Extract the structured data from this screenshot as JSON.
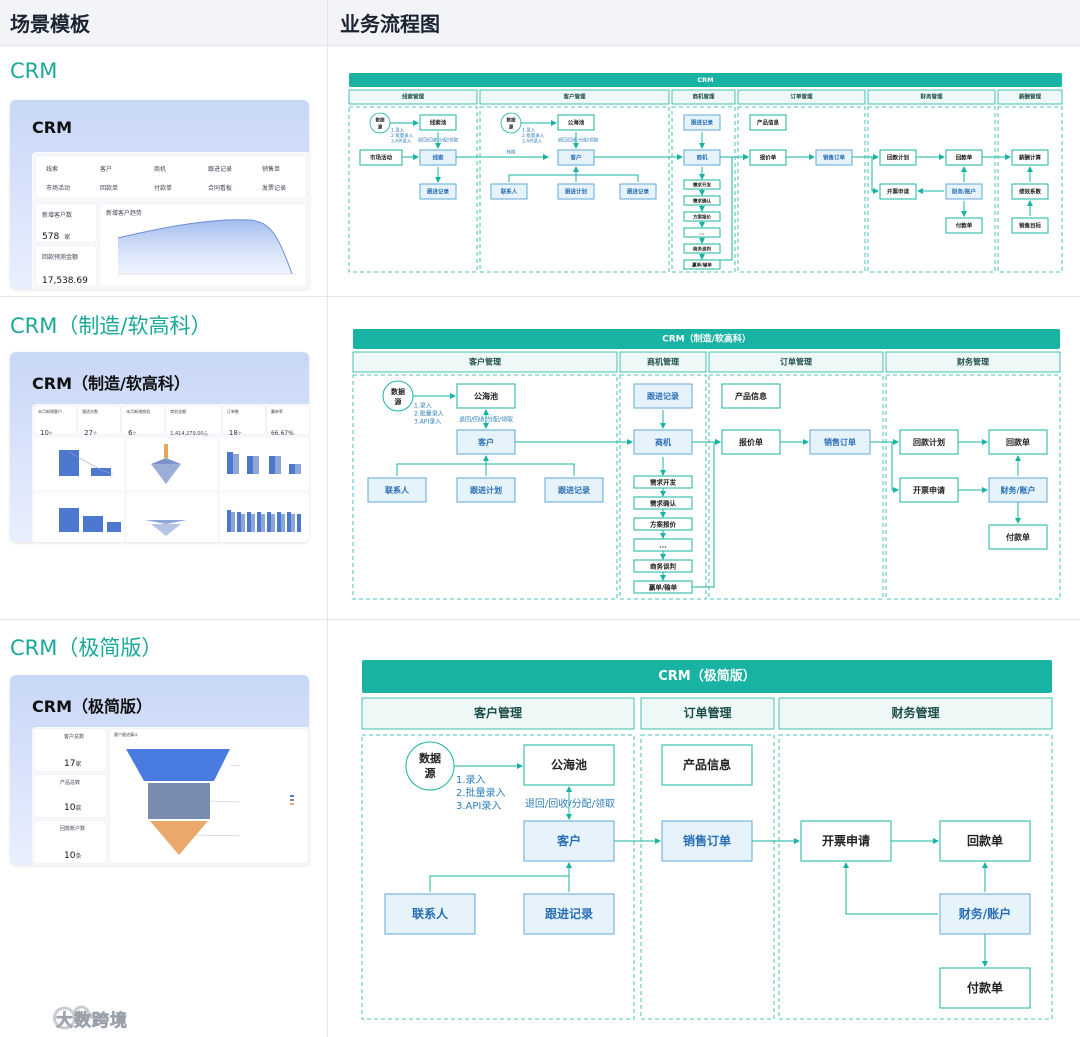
{
  "header": {
    "left": "场景模板",
    "right": "业务流程图"
  },
  "scenes": [
    {
      "title": "CRM",
      "thumb": {
        "title": "CRM",
        "nav": [
          "线索",
          "客户",
          "商机",
          "跟进记录",
          "销售单",
          "市场活动",
          "回款单",
          "付款单",
          "合同看板",
          "发票记录"
        ],
        "stats": [
          {
            "label": "新增客户数",
            "value": "578",
            "unit": "家"
          },
          {
            "label": "回款预测金额",
            "value": "17,538.69",
            "unit": "元"
          }
        ],
        "chart_title": "新增客户趋势"
      },
      "flow": {
        "title": "CRM",
        "sections": [
          "线索管理",
          "客户管理",
          "商机管理",
          "订单管理",
          "财务管理",
          "薪酬管理"
        ],
        "nodes": {
          "datasource": "数据源",
          "market": "市场活动",
          "clue_pool": "线索池",
          "clue": "线索",
          "clue_follow": "跟进记录",
          "sea": "公海池",
          "customer": "客户",
          "contact": "联系人",
          "plan": "跟进计划",
          "cust_follow": "跟进记录",
          "opp_follow": "跟进记录",
          "opp": "商机",
          "s1": "需求开发",
          "s2": "需求确认",
          "s3": "方案报价",
          "s4": "...",
          "s5": "商务谈判",
          "s6": "赢单/输单",
          "product": "产品信息",
          "quote": "报价单",
          "sales": "销售订单",
          "plan_back": "回款计划",
          "refund": "回款单",
          "invoice": "开票申请",
          "account": "财务/账户",
          "pay": "付款单",
          "salary": "薪酬计算",
          "perf": "绩效系数",
          "target": "销售目标"
        },
        "labels": {
          "entry": "1.录入\n2.批量录入\n3.API录入",
          "reassign": "退回/回收/分配/领取",
          "convert": "转换"
        }
      }
    },
    {
      "title": "CRM（制造/软高科）",
      "thumb": {
        "title": "CRM（制造/软高科）",
        "stats": [
          {
            "label": "本月新增客户",
            "value": "10",
            "unit": "个"
          },
          {
            "label": "跟进次数",
            "value": "27",
            "unit": "个"
          },
          {
            "label": "本月新增商机",
            "value": "6",
            "unit": "个"
          },
          {
            "label": "商机金额",
            "value": "1,414,279.00",
            "unit": "元"
          },
          {
            "label": "订单数",
            "value": "18",
            "unit": "个"
          },
          {
            "label": "赢单率",
            "value": "66.67%",
            "unit": ""
          }
        ]
      },
      "flow": {
        "title": "CRM（制造/软高科）",
        "sections": [
          "客户管理",
          "商机管理",
          "订单管理",
          "财务管理"
        ],
        "nodes": {
          "datasource": "数据源",
          "sea": "公海池",
          "customer": "客户",
          "contact": "联系人",
          "plan": "跟进计划",
          "cust_follow": "跟进记录",
          "opp_follow": "跟进记录",
          "opp": "商机",
          "s1": "需求开发",
          "s2": "需求确认",
          "s3": "方案报价",
          "s4": "...",
          "s5": "商务谈判",
          "s6": "赢单/输单",
          "product": "产品信息",
          "quote": "报价单",
          "sales": "销售订单",
          "plan_back": "回款计划",
          "refund": "回款单",
          "invoice": "开票申请",
          "account": "财务/账户",
          "pay": "付款单"
        },
        "labels": {
          "entry": "1.录入\n2.批量录入\n3.API录入",
          "reassign": "退回/回收/分配/领取"
        }
      }
    },
    {
      "title": "CRM（极简版）",
      "thumb": {
        "title": "CRM（极简版）",
        "stats": [
          {
            "label": "客户总数",
            "value": "17",
            "unit": "家"
          },
          {
            "label": "产品总数",
            "value": "10",
            "unit": "款"
          },
          {
            "label": "回款账户数",
            "value": "10",
            "unit": "条"
          }
        ],
        "chart_title": "客户跟进漏斗"
      },
      "flow": {
        "title": "CRM（极简版）",
        "sections": [
          "客户管理",
          "订单管理",
          "财务管理"
        ],
        "nodes": {
          "datasource": "数据源",
          "sea": "公海池",
          "customer": "客户",
          "contact": "联系人",
          "cust_follow": "跟进记录",
          "product": "产品信息",
          "sales": "销售订单",
          "invoice": "开票申请",
          "refund": "回款单",
          "account": "财务/账户",
          "pay": "付款单"
        },
        "labels": {
          "entry": "1.录入\n2.批量录入\n3.API录入",
          "reassign": "退回/回收/分配/领取"
        }
      }
    }
  ],
  "watermark": "大数跨境",
  "colors": {
    "teal": "#18b3a2",
    "accent": "#1aa999",
    "node_blue": "#2a6fb5",
    "node_fill": "#e6f3fb"
  }
}
